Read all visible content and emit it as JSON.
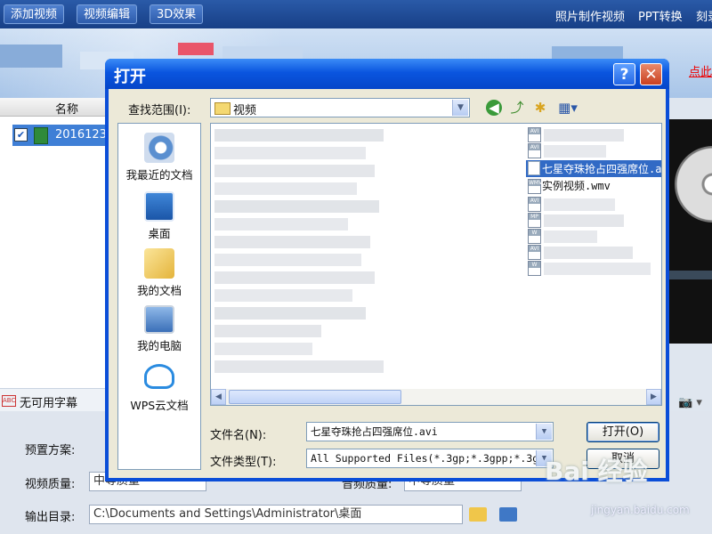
{
  "app": {
    "toolbar": {
      "add_video": "添加视频",
      "edit_video": "视频编辑",
      "effect_3d": "3D效果"
    },
    "right_links": {
      "photo_video": "照片制作视频",
      "ppt": "PPT转换",
      "burn": "刻录"
    },
    "red_link": "点此",
    "list": {
      "col_name": "名称",
      "item_name": "2016123"
    },
    "subtitle": "无可用字幕",
    "bottom": {
      "preset_label": "预置方案:",
      "quality_label": "视频质量:",
      "quality_value": "中等质量",
      "audio_quality_label": "音频质量:",
      "audio_quality_value": "中等质量",
      "output_label": "输出目录:",
      "output_value": "C:\\Documents and Settings\\Administrator\\桌面"
    }
  },
  "dialog": {
    "title": "打开",
    "help_glyph": "?",
    "close_glyph": "✕",
    "lookin_label": "查找范围(I):",
    "lookin_value": "视频",
    "places": [
      {
        "label": "我最近的文档",
        "icon": "recent-docs-icon"
      },
      {
        "label": "桌面",
        "icon": "desktop-icon"
      },
      {
        "label": "我的文档",
        "icon": "my-documents-icon"
      },
      {
        "label": "我的电脑",
        "icon": "my-computer-icon"
      },
      {
        "label": "WPS云文档",
        "icon": "wps-cloud-icon"
      }
    ],
    "selected_file": "七星夺珠抢占四强席位.avi",
    "next_file": "实例视频.wmv",
    "filename_label": "文件名(N):",
    "filename_value": "七星夺珠抢占四强席位.avi",
    "filetype_label": "文件类型(T):",
    "filetype_value": "All Supported Files(*.3gp;*.3gpp;*.3g",
    "open_btn": "打开(O)",
    "cancel_btn": "取消"
  },
  "watermark": {
    "text": "Bai 经验",
    "url": "jingyan.baidu.com"
  },
  "colors": {
    "title_blue": "#0a55df",
    "selection": "#316ac5",
    "close_red": "#c9401f"
  }
}
